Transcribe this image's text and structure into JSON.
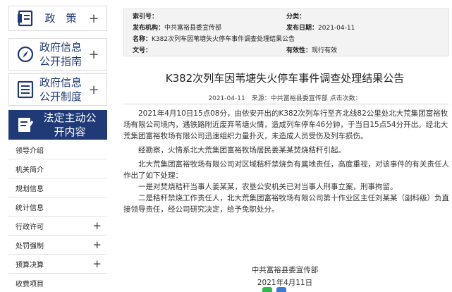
{
  "sidebar": {
    "big_items": [
      {
        "label": "政　策",
        "icon": "document-icon",
        "has_plus": true
      },
      {
        "label": "政府信息公开指南",
        "icon": "compass-icon",
        "has_plus": true
      },
      {
        "label": "政府信息公开制度",
        "icon": "list-doc-icon",
        "has_plus": true
      },
      {
        "label": "法定主动公开内容",
        "icon": "edit-doc-icon",
        "has_plus": false,
        "active": true
      }
    ],
    "sub_items": [
      {
        "label": "领导介绍",
        "has_plus": false
      },
      {
        "label": "机关简介",
        "has_plus": false
      },
      {
        "label": "规划信息",
        "has_plus": false
      },
      {
        "label": "统计信息",
        "has_plus": false
      },
      {
        "label": "行政许可",
        "has_plus": true
      },
      {
        "label": "处罚强制",
        "has_plus": true
      },
      {
        "label": "预算决算",
        "has_plus": true
      },
      {
        "label": "收费项目",
        "has_plus": false
      }
    ]
  },
  "meta": {
    "index_no_key": "索引号：",
    "index_no_value": "",
    "category_key": "分类：",
    "category_value": "",
    "publisher_key": "发布机构：",
    "publisher_value": "中共富裕县委宣传部",
    "date_key": "发布日期：",
    "date_value": "2021-04-11",
    "name_key": "名称：",
    "name_value": "K382次列车因苇塘失火停车事件调查处理结果公告",
    "doc_no_key": "文号：",
    "doc_no_value": "",
    "validity_key": "有效性：",
    "validity_value": "现行有效"
  },
  "article": {
    "title": "K382次列车因苇塘失火停车事件调查处理结果公告",
    "byline": "2021-04-11　来源：中共富裕县委宣传部 点击次数：",
    "paragraphs": [
      "2021年4月10日15点08分，由依安开出的K382次列车行至齐北线82公里处北大荒集团富裕牧场有限公司境内，遇铁路附近废弃苇塘火情，造成列车停车46分钟，于当日15点54分开出。经北大荒集团富裕牧场有限公司迅速组织力量扑灭，未造成人员受伤及列车损伤。",
      "经勘察，火情系北大荒集团富裕牧场居民姜某某焚烧秸秆引起。",
      "北大荒集团富裕牧场有限公司对区域秸秆禁烧负有属地责任，高度重视，对该事件的有关责任人作出了如下处理：",
      "一是对焚烧秸秆当事人姜某某，农垦公安机关已对当事人刑事立案，刑事拘留。",
      "二是秸秆禁烧工作责任人，北大荒集团富裕牧场有限公司第十作业区主任刘某某（副科级）负直接领导责任，经公司研究决定，给予免职处分。"
    ],
    "signature_org": "中共富裕县委宣传部",
    "signature_date": "2021年4月11日"
  }
}
